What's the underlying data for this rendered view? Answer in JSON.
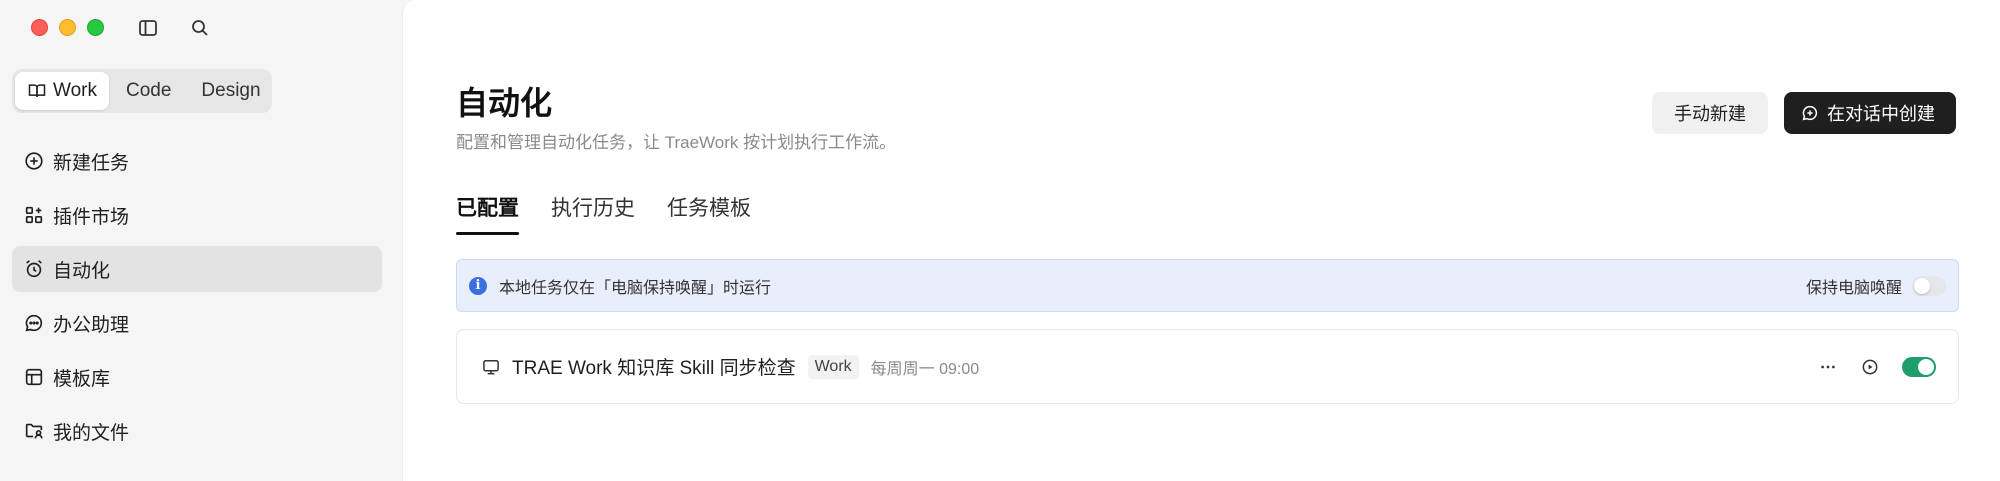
{
  "sidebar": {
    "modes": [
      {
        "label": "Work",
        "active": true
      },
      {
        "label": "Code",
        "active": false
      },
      {
        "label": "Design",
        "active": false
      }
    ],
    "items": [
      {
        "label": "新建任务",
        "icon": "plus-circle-icon"
      },
      {
        "label": "插件市场",
        "icon": "plugin-grid-icon"
      },
      {
        "label": "自动化",
        "icon": "alarm-clock-icon",
        "active": true
      },
      {
        "label": "办公助理",
        "icon": "chat-bubble-icon"
      },
      {
        "label": "模板库",
        "icon": "template-icon"
      },
      {
        "label": "我的文件",
        "icon": "folder-user-icon"
      }
    ]
  },
  "main": {
    "title": "自动化",
    "subtitle": "配置和管理自动化任务，让 TraeWork 按计划执行工作流。",
    "manual_button": "手动新建",
    "chat_button": "在对话中创建",
    "tabs": [
      {
        "label": "已配置",
        "active": true
      },
      {
        "label": "执行历史",
        "active": false
      },
      {
        "label": "任务模板",
        "active": false
      }
    ],
    "banner": {
      "text": "本地任务仅在「电脑保持唤醒」时运行",
      "toggle_label": "保持电脑唤醒",
      "toggle_on": false
    },
    "tasks": [
      {
        "title": "TRAE Work 知识库 Skill 同步检查",
        "tag": "Work",
        "schedule": "每周周一 09:00",
        "enabled": true
      }
    ]
  },
  "colors": {
    "accent_toggle": "#1f9d6b",
    "banner_bg": "#e9eefc",
    "info_icon": "#3b6fe0",
    "primary_button": "#1f1f1f"
  }
}
